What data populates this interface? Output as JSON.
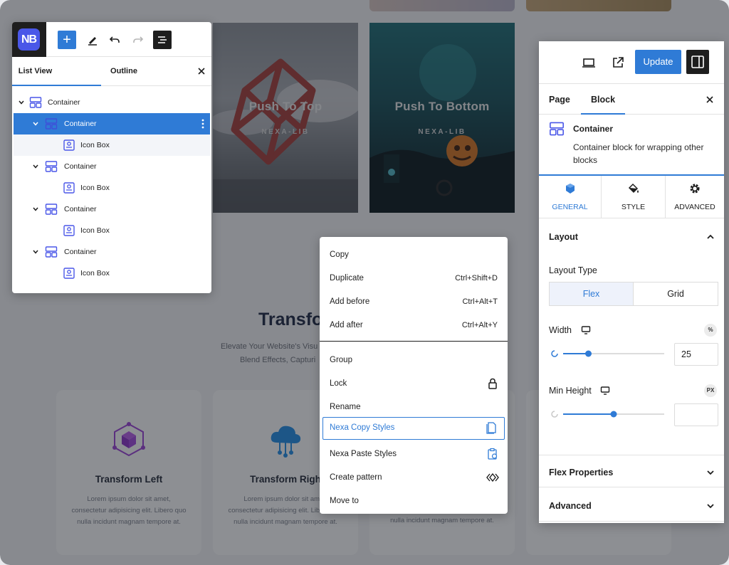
{
  "canvas": {
    "cards": [
      {
        "caption": "Push To Top",
        "brand": "NEXA-LIB"
      },
      {
        "caption": "Push To Bottom",
        "brand": "NEXA-LIB"
      }
    ],
    "heading": "Transfo",
    "sub_line_1": "Elevate Your Website's Visu",
    "sub_line_2": "Blend Effects, Capturi",
    "features": [
      {
        "title": "Transform Left",
        "description": "Lorem ipsum dolor sit amet, consectetur adipisicing elit. Libero quo nulla incidunt magnam tempore at."
      },
      {
        "title": "Transform Righ",
        "description": "Lorem ipsum dolor sit amet, consectetur adipisicing elit. Libero quo nulla incidunt magnam tempore at."
      },
      {
        "title": "",
        "description": "nulla incidunt magnam tempore at."
      }
    ]
  },
  "list_view": {
    "logo_text": "NB",
    "add_label": "+",
    "tabs": {
      "list": "List View",
      "outline": "Outline"
    },
    "tree": [
      {
        "label": "Container",
        "depth": 0,
        "expanded": true,
        "icon": "container-icon",
        "state": "normal"
      },
      {
        "label": "Container",
        "depth": 1,
        "expanded": true,
        "icon": "container-icon",
        "state": "selected"
      },
      {
        "label": "Icon Box",
        "depth": 2,
        "icon": "icon-box-icon",
        "state": "hover"
      },
      {
        "label": "Container",
        "depth": 1,
        "expanded": true,
        "icon": "container-icon",
        "state": "normal"
      },
      {
        "label": "Icon Box",
        "depth": 2,
        "icon": "icon-box-icon",
        "state": "normal"
      },
      {
        "label": "Container",
        "depth": 1,
        "expanded": true,
        "icon": "container-icon",
        "state": "normal"
      },
      {
        "label": "Icon Box",
        "depth": 2,
        "icon": "icon-box-icon",
        "state": "normal"
      },
      {
        "label": "Container",
        "depth": 1,
        "expanded": true,
        "icon": "container-icon",
        "state": "normal"
      },
      {
        "label": "Icon Box",
        "depth": 2,
        "icon": "icon-box-icon",
        "state": "normal"
      }
    ]
  },
  "context_menu": {
    "items": [
      {
        "label": "Copy",
        "shortcut": ""
      },
      {
        "label": "Duplicate",
        "shortcut": "Ctrl+Shift+D"
      },
      {
        "label": "Add before",
        "shortcut": "Ctrl+Alt+T"
      },
      {
        "label": "Add after",
        "shortcut": "Ctrl+Alt+Y"
      },
      {
        "label": "Group",
        "shortcut": ""
      },
      {
        "label": "Lock",
        "icon": "lock-icon"
      },
      {
        "label": "Rename",
        "shortcut": ""
      },
      {
        "label": "Nexa Copy Styles",
        "icon": "copy-styles-icon",
        "focused": true
      },
      {
        "label": "Nexa Paste Styles",
        "icon": "paste-styles-icon"
      },
      {
        "label": "Create pattern",
        "icon": "pattern-icon"
      },
      {
        "label": "Move to",
        "shortcut": ""
      }
    ]
  },
  "sidebar": {
    "update_label": "Update",
    "tabs": {
      "page": "Page",
      "block": "Block"
    },
    "block": {
      "title": "Container",
      "description": "Container block for wrapping other blocks"
    },
    "panel_tabs": [
      {
        "label": "GENERAL",
        "icon": "cube-icon",
        "active": true
      },
      {
        "label": "STYLE",
        "icon": "paint-bucket-icon",
        "active": false
      },
      {
        "label": "ADVANCED",
        "icon": "gear-icon",
        "active": false
      }
    ],
    "layout": {
      "title": "Layout",
      "layout_type_label": "Layout Type",
      "options": [
        "Flex",
        "Grid"
      ],
      "selected": "Flex",
      "width_label": "Width",
      "width_unit": "%",
      "width_value": "25",
      "width_fraction": 0.25,
      "min_height_label": "Min Height",
      "min_height_unit": "PX",
      "min_height_value": "",
      "min_height_fraction": 0.5
    },
    "sections": [
      "Flex Properties",
      "Advanced"
    ],
    "accent_color": "#2f7bd6"
  }
}
